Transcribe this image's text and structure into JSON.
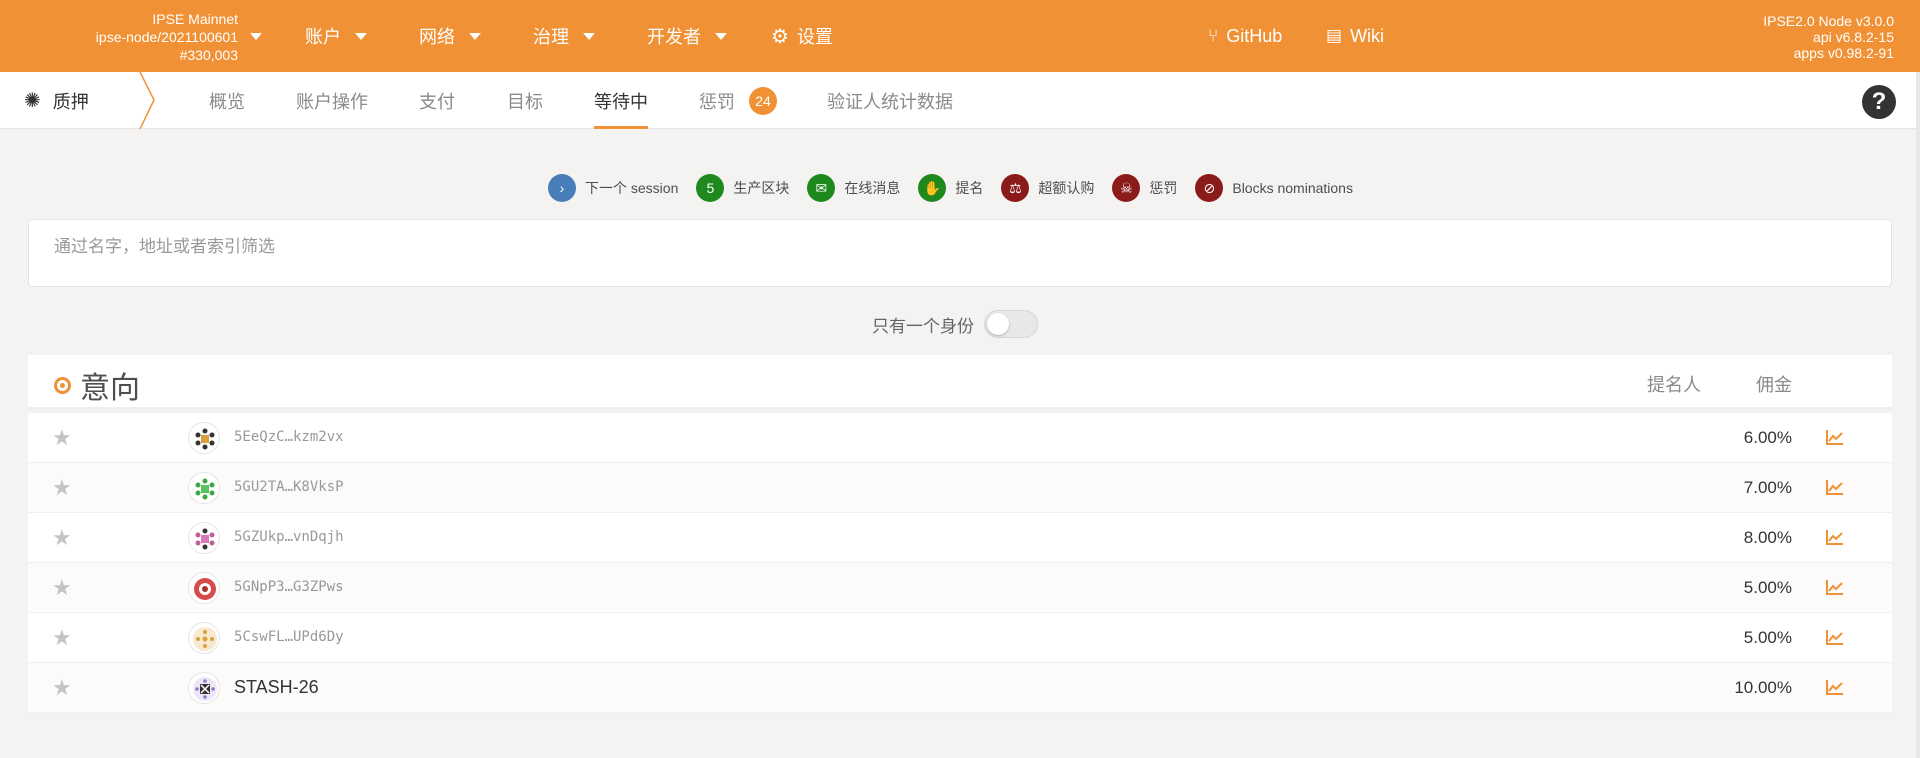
{
  "topbar": {
    "chain_name": "IPSE Mainnet",
    "node_name": "ipse-node/2021100601",
    "block_number": "#330,003",
    "menu": [
      {
        "label": "账户"
      },
      {
        "label": "网络"
      },
      {
        "label": "治理"
      },
      {
        "label": "开发者"
      },
      {
        "label": "设置"
      }
    ],
    "links": [
      {
        "label": "GitHub"
      },
      {
        "label": "Wiki"
      }
    ],
    "version": {
      "node": "IPSE2.0 Node v3.0.0",
      "api": "api v6.8.2-15",
      "apps": "apps v0.98.2-91"
    }
  },
  "subnav": {
    "section_label": "质押",
    "tabs": [
      {
        "label": "概览"
      },
      {
        "label": "账户操作"
      },
      {
        "label": "支付"
      },
      {
        "label": "目标"
      },
      {
        "label": "等待中"
      },
      {
        "label": "惩罚",
        "count": "24"
      },
      {
        "label": "验证人统计数据"
      }
    ]
  },
  "legend": [
    {
      "symbol": "›",
      "label": "下一个 session",
      "color": "#4a7eb8"
    },
    {
      "symbol": "5",
      "label": "生产区块",
      "color": "#1e8a1e"
    },
    {
      "symbol": "✉",
      "label": "在线消息",
      "color": "#1e8a1e"
    },
    {
      "symbol": "✋",
      "label": "提名",
      "color": "#1e8a1e"
    },
    {
      "symbol": "⚖",
      "label": "超额认购",
      "color": "#8b1a1a"
    },
    {
      "symbol": "☠",
      "label": "惩罚",
      "color": "#8b1a1a"
    },
    {
      "symbol": "⊘",
      "label": "Blocks nominations",
      "color": "#8b1a1a"
    }
  ],
  "filter": {
    "placeholder": "通过名字，地址或者索引筛选"
  },
  "toggle": {
    "label": "只有一个身份"
  },
  "table": {
    "title": "意向",
    "headers": {
      "nominators": "提名人",
      "commission": "佣金"
    },
    "rows": [
      {
        "address": "5EeQzC…kzm2vx",
        "commission": "6.00%"
      },
      {
        "address": "5GU2TA…K8VksP",
        "commission": "7.00%"
      },
      {
        "address": "5GZUkp…vnDqjh",
        "commission": "8.00%"
      },
      {
        "address": "5GNpP3…G3ZPws",
        "commission": "5.00%"
      },
      {
        "address": "5CswFL…UPd6Dy",
        "commission": "5.00%"
      },
      {
        "address": "STASH-26",
        "commission": "10.00%"
      }
    ]
  },
  "colors": {
    "accent": "#f19135",
    "dark": "#333333"
  }
}
